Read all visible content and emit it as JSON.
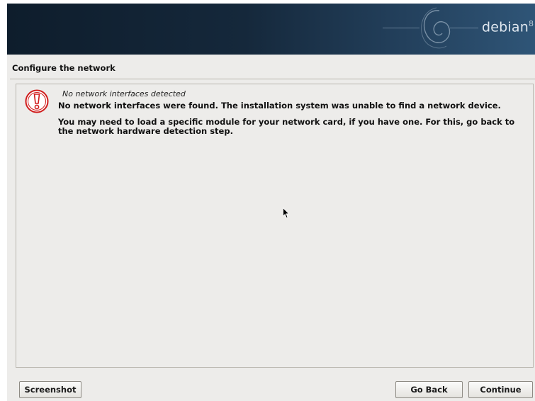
{
  "banner": {
    "brand": "debian",
    "version": "8"
  },
  "step": {
    "title": "Configure the network"
  },
  "message": {
    "icon": "warning-exclamation-icon",
    "heading": "No network interfaces detected",
    "primary": "No network interfaces were found. The installation system was unable to find a network device.",
    "secondary": "You may need to load a specific module for your network card, if you have one. For this, go back to the network hardware detection step."
  },
  "buttons": {
    "screenshot": "Screenshot",
    "go_back": "Go Back",
    "continue": "Continue"
  },
  "colors": {
    "alert_red": "#d01c1c",
    "panel_background": "#edecea",
    "banner_dark": "#0e1d2c"
  }
}
